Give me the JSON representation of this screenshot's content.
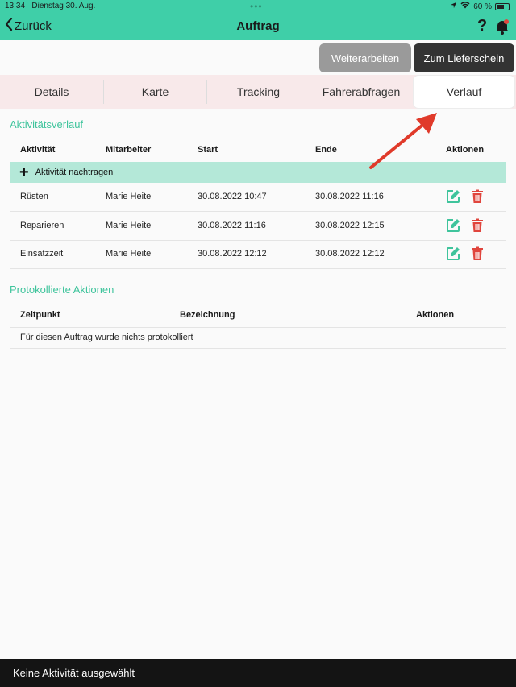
{
  "status_bar": {
    "time": "13:34",
    "date": "Dienstag 30. Aug.",
    "battery": "60 %"
  },
  "header": {
    "back_label": "Zurück",
    "title": "Auftrag",
    "help_symbol": "?"
  },
  "actions": {
    "continue_label": "Weiterarbeiten",
    "delivery_label": "Zum Lieferschein"
  },
  "tabs": [
    {
      "label": "Details"
    },
    {
      "label": "Karte"
    },
    {
      "label": "Tracking"
    },
    {
      "label": "Fahrerabfragen"
    },
    {
      "label": "Verlauf"
    }
  ],
  "activity": {
    "title": "Aktivitätsverlauf",
    "columns": [
      "Aktivität",
      "Mitarbeiter",
      "Start",
      "Ende",
      "Aktionen"
    ],
    "add_label": "Aktivität nachtragen",
    "rows": [
      {
        "activity": "Rüsten",
        "employee": "Marie Heitel",
        "start": "30.08.2022 10:47",
        "end": "30.08.2022 11:16"
      },
      {
        "activity": "Reparieren",
        "employee": "Marie Heitel",
        "start": "30.08.2022 11:16",
        "end": "30.08.2022 12:15"
      },
      {
        "activity": "Einsatzzeit",
        "employee": "Marie Heitel",
        "start": "30.08.2022 12:12",
        "end": "30.08.2022 12:12"
      }
    ]
  },
  "log": {
    "title": "Protokollierte Aktionen",
    "columns": [
      "Zeitpunkt",
      "Bezeichnung",
      "Aktionen"
    ],
    "empty_text": "Für diesen Auftrag wurde nichts protokolliert"
  },
  "footer": {
    "text": "Keine Aktivität ausgewählt"
  },
  "colors": {
    "accent": "#3fcfa8",
    "delete": "#e0453d",
    "arrow": "#e03a2a"
  }
}
